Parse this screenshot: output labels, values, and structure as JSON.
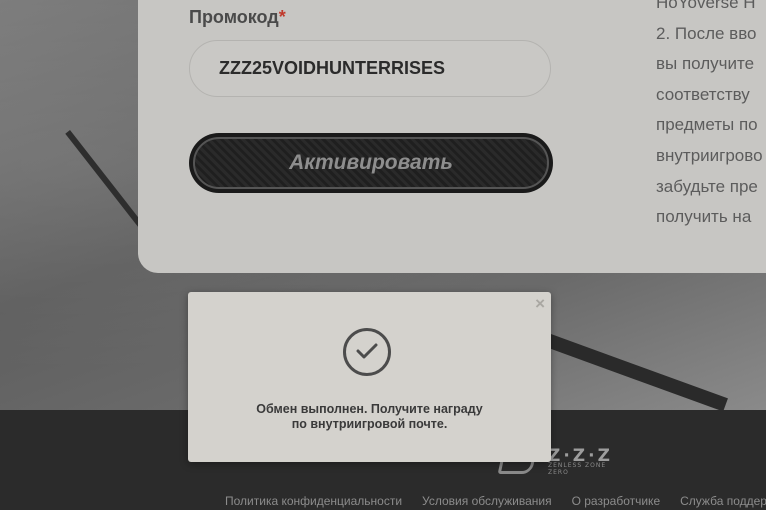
{
  "form": {
    "promo_label": "Промокод",
    "required_mark": "*",
    "promo_value": "ZZZ25VOIDHUNTERRISES",
    "activate_label": "Активировать"
  },
  "instructions": {
    "lines": [
      "HoYoverse H",
      "2. После вво",
      "вы получите",
      "соответству",
      "предметы по",
      "внутриигрово",
      "забудьте пре",
      "получить на"
    ]
  },
  "modal": {
    "close_label": "×",
    "message_line1": "Обмен выполнен. Получите награду",
    "message_line2": "по внутриигровой почте.",
    "icon": "check-circle-icon"
  },
  "footer": {
    "logo_text": "Z·Z·Z",
    "logo_sub": "ZENLESS ZONE ZERO",
    "links": [
      "Политика конфиденциальности",
      "Условия обслуживания",
      "О разработчике",
      "Служба поддер"
    ]
  },
  "colors": {
    "card": "#c7c6c3",
    "modal": "#d4d2cd",
    "footer": "#2b2b2b",
    "required": "#c0392b"
  }
}
